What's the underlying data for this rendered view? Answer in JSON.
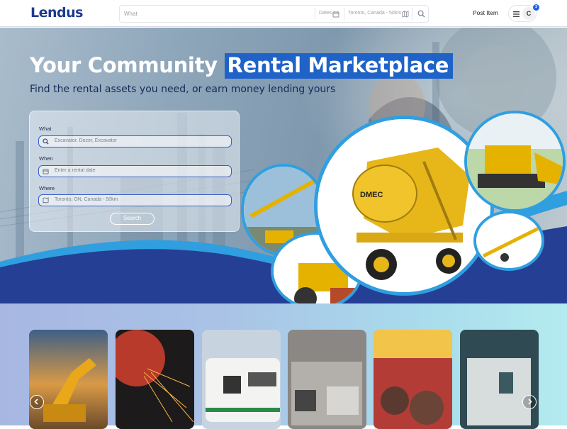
{
  "header": {
    "logo": "Lendus",
    "search": {
      "what_placeholder": "What",
      "dates_placeholder": "Dates",
      "location_placeholder": "Toronto, Canada - 50km"
    },
    "post_item_label": "Post Item",
    "avatar_initial": "C",
    "notification_count": "3"
  },
  "hero": {
    "title_plain": "Your Community",
    "title_highlight": "Rental Marketplace",
    "subtitle": "Find the rental assets you need, or earn money lending yours",
    "form": {
      "what_label": "What",
      "what_placeholder": "Excavator, Dozer, Excavator",
      "when_label": "When",
      "when_placeholder": "Enter a rental date",
      "where_label": "Where",
      "where_value": "Toronto, ON, Canada - 50km",
      "search_button": "Search"
    }
  },
  "categories": {
    "cards": [
      {
        "icon": "excavator-image"
      },
      {
        "icon": "welding-sparks-image"
      },
      {
        "icon": "rv-camper-image"
      },
      {
        "icon": "kitchen-equipment-image"
      },
      {
        "icon": "concert-crowd-image"
      },
      {
        "icon": "medical-equipment-image"
      }
    ]
  },
  "colors": {
    "brand": "#1c3a8e",
    "accent": "#1f63c8",
    "wave_light": "#2f9fe0",
    "wave_dark": "#243f94"
  }
}
